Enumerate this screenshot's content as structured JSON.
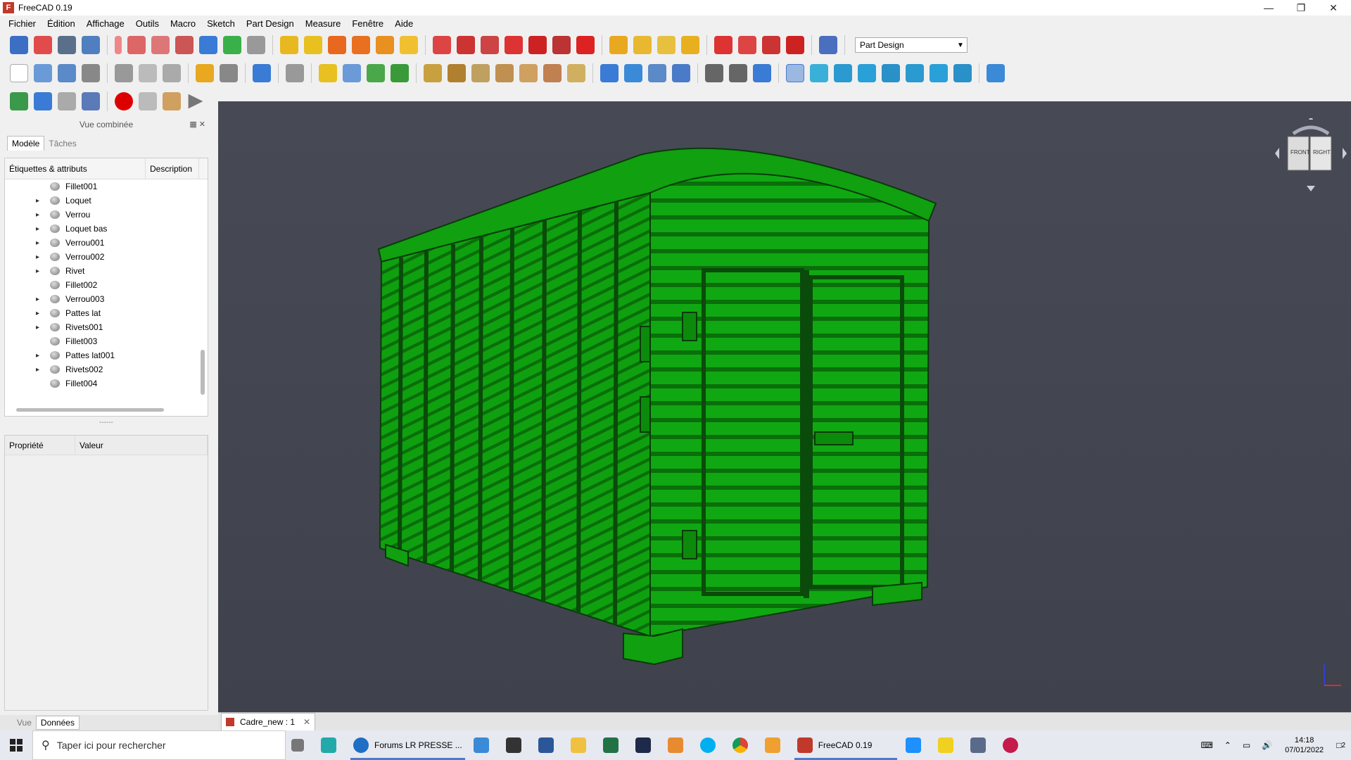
{
  "window": {
    "title": "FreeCAD 0.19"
  },
  "menu": [
    "Fichier",
    "Édition",
    "Affichage",
    "Outils",
    "Macro",
    "Sketch",
    "Part Design",
    "Measure",
    "Fenêtre",
    "Aide"
  ],
  "workbench": {
    "selected": "Part Design"
  },
  "combo_view": {
    "title": "Vue combinée",
    "tabs": [
      "Modèle",
      "Tâches"
    ],
    "tree_headers": [
      "Étiquettes & attributs",
      "Description"
    ],
    "tree_items": [
      {
        "label": "Fillet001",
        "expandable": false
      },
      {
        "label": "Loquet",
        "expandable": true
      },
      {
        "label": "Verrou",
        "expandable": true
      },
      {
        "label": "Loquet bas",
        "expandable": true
      },
      {
        "label": "Verrou001",
        "expandable": true
      },
      {
        "label": "Verrou002",
        "expandable": true
      },
      {
        "label": "Rivet",
        "expandable": true
      },
      {
        "label": "Fillet002",
        "expandable": false
      },
      {
        "label": "Verrou003",
        "expandable": true
      },
      {
        "label": "Pattes lat",
        "expandable": true
      },
      {
        "label": "Rivets001",
        "expandable": true
      },
      {
        "label": "Fillet003",
        "expandable": false
      },
      {
        "label": "Pattes lat001",
        "expandable": true
      },
      {
        "label": "Rivets002",
        "expandable": true
      },
      {
        "label": "Fillet004",
        "expandable": false
      }
    ],
    "prop_headers": [
      "Propriété",
      "Valeur"
    ],
    "bottom_tabs": [
      "Vue",
      "Données"
    ]
  },
  "document_tab": {
    "label": "Cadre_new : 1"
  },
  "navcube": {
    "front": "FRONT",
    "right": "RIGHT"
  },
  "taskbar": {
    "search_placeholder": "Taper ici pour rechercher",
    "apps": [
      {
        "label": "Forums LR PRESSE ...",
        "color": "#1f6fc5"
      },
      {
        "label": "FreeCAD 0.19",
        "color": "#c0392b"
      }
    ],
    "time": "14:18",
    "date": "07/01/2022",
    "notifications": "2"
  }
}
